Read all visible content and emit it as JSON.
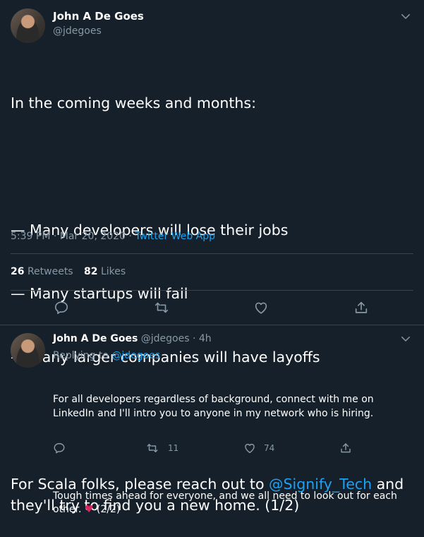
{
  "main_tweet": {
    "author_name": "John A De Goes",
    "author_handle": "@jdegoes",
    "text_intro": "In the coming weeks and months:",
    "bullets": [
      "— Many developers will lose their jobs",
      "— Many startups will fail",
      "— Many larger companies will have layoffs"
    ],
    "text_cta_before": "For Scala folks, please reach out to ",
    "mention": "@Signify_Tech",
    "text_cta_after": " and they'll try to find you a new home. (1/2)",
    "time": "5:39 PM · Mar 20, 2020",
    "meta_separator": " · ",
    "source": "Twitter Web App",
    "retweets_count": "26",
    "retweets_label": "Retweets",
    "likes_count": "82",
    "likes_label": "Likes",
    "icons": [
      "chevron-down-icon",
      "reply-icon",
      "retweet-icon",
      "like-icon",
      "share-icon"
    ]
  },
  "reply_tweet": {
    "author_name": "John A De Goes",
    "author_handle": "@jdegoes",
    "dot": "·",
    "age": "4h",
    "replying_to_label": "Replying to ",
    "replying_to_handle": "@jdegoes",
    "paragraph1": "For all developers regardless of background, connect with me on LinkedIn and I'll intro you to anyone in my network who is hiring.",
    "paragraph2_before": "Tough times ahead for everyone, and we all need to look out for each other. ",
    "heart_emoji": "♥",
    "paragraph2_after": " (2/2)",
    "retweet_count": "11",
    "like_count": "74",
    "icons": [
      "chevron-down-icon",
      "reply-icon",
      "retweet-icon",
      "like-icon",
      "share-icon"
    ]
  },
  "colors": {
    "background": "#15202b",
    "text": "#ffffff",
    "muted": "#8899a6",
    "accent": "#1da1f2",
    "divider": "#38444d",
    "heart": "#e0245e"
  }
}
